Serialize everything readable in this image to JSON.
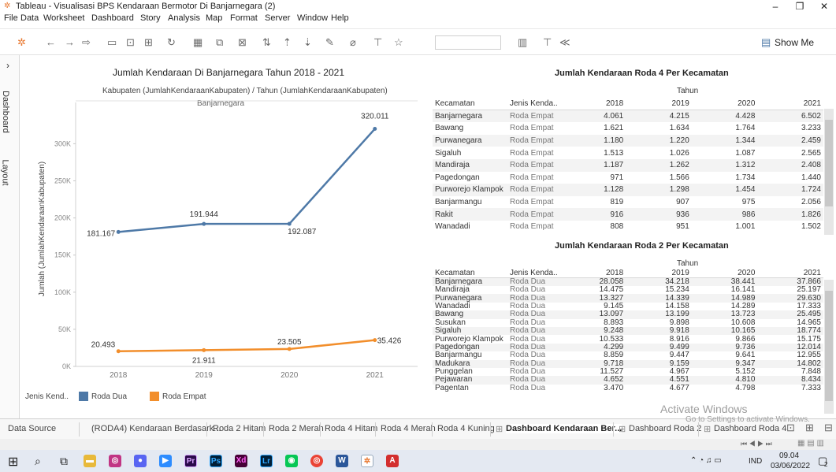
{
  "window": {
    "title": "Tableau - Visualisasi BPS Kendaraan Bermotor Di Banjarnegara (2)",
    "minimize": "–",
    "restore": "❐",
    "close": "✕"
  },
  "menu": [
    "File",
    "Data",
    "Worksheet",
    "Dashboard",
    "Story",
    "Analysis",
    "Map",
    "Format",
    "Server",
    "Window",
    "Help"
  ],
  "toolbar": {
    "show_me": "Show Me"
  },
  "left_rail": {
    "dashboard": "Dashboard",
    "layout": "Layout",
    "collapse": "›"
  },
  "line_chart": {
    "title": "Jumlah Kendaraan Di Banjarnegara Tahun 2018 - 2021",
    "header": "Kabupaten (JumlahKendaraanKabupaten) / Tahun (JumlahKendaraanKabupaten)",
    "subheader": "Banjarnegara",
    "ylabel": "Jumlah (JumlahKendaraanKabupaten)",
    "legend_title": "Jenis Kend..",
    "colors": {
      "Roda Dua": "#4e79a7",
      "Roda Empat": "#f28e2b"
    }
  },
  "chart_data": {
    "type": "line",
    "x": [
      "2018",
      "2019",
      "2020",
      "2021"
    ],
    "ylim": [
      0,
      345000
    ],
    "yticks": [
      0,
      50000,
      100000,
      150000,
      200000,
      250000,
      300000
    ],
    "ytick_labels": [
      "0K",
      "50K",
      "100K",
      "150K",
      "200K",
      "250K",
      "300K"
    ],
    "series": [
      {
        "name": "Roda Dua",
        "values": [
          181167,
          191944,
          192087,
          320011
        ],
        "labels": [
          "181.167",
          "191.944",
          "192.087",
          "320.011"
        ]
      },
      {
        "name": "Roda Empat",
        "values": [
          20493,
          21911,
          23505,
          35426
        ],
        "labels": [
          "20.493",
          "21.911",
          "23.505",
          "35.426"
        ]
      }
    ],
    "xlabel": "",
    "grid": false,
    "legend": "bottom-left"
  },
  "table4": {
    "title": "Jumlah Kendaraan Roda 4 Per Kecamatan",
    "group_header": "Tahun",
    "columns": [
      "Kecamatan",
      "Jenis Kenda..",
      "2018",
      "2019",
      "2020",
      "2021"
    ],
    "rows": [
      [
        "Banjarnegara",
        "Roda Empat",
        "4.061",
        "4.215",
        "4.428",
        "6.502"
      ],
      [
        "Bawang",
        "Roda Empat",
        "1.621",
        "1.634",
        "1.764",
        "3.233"
      ],
      [
        "Purwanegara",
        "Roda Empat",
        "1.180",
        "1.220",
        "1.344",
        "2.459"
      ],
      [
        "Sigaluh",
        "Roda Empat",
        "1.513",
        "1.026",
        "1.087",
        "2.565"
      ],
      [
        "Mandiraja",
        "Roda Empat",
        "1.187",
        "1.262",
        "1.312",
        "2.408"
      ],
      [
        "Pagedongan",
        "Roda Empat",
        "971",
        "1.566",
        "1.734",
        "1.440"
      ],
      [
        "Purworejo Klampok",
        "Roda Empat",
        "1.128",
        "1.298",
        "1.454",
        "1.724"
      ],
      [
        "Banjarmangu",
        "Roda Empat",
        "819",
        "907",
        "975",
        "2.056"
      ],
      [
        "Rakit",
        "Roda Empat",
        "916",
        "936",
        "986",
        "1.826"
      ],
      [
        "Wanadadi",
        "Roda Empat",
        "808",
        "951",
        "1.001",
        "1.502"
      ]
    ]
  },
  "table2": {
    "title": "Jumlah Kendaraan Roda 2 Per Kecamatan",
    "group_header": "Tahun",
    "columns": [
      "Kecamatan",
      "Jenis Kenda..",
      "2018",
      "2019",
      "2020",
      "2021"
    ],
    "rows": [
      [
        "Banjarnegara",
        "Roda Dua",
        "28.058",
        "34.218",
        "38.441",
        "37.866"
      ],
      [
        "Mandiraja",
        "Roda Dua",
        "14.475",
        "15.234",
        "16.141",
        "25.197"
      ],
      [
        "Purwanegara",
        "Roda Dua",
        "13.327",
        "14.339",
        "14.989",
        "29.630"
      ],
      [
        "Wanadadi",
        "Roda Dua",
        "9.145",
        "14.158",
        "14.289",
        "17.333"
      ],
      [
        "Bawang",
        "Roda Dua",
        "13.097",
        "13.199",
        "13.723",
        "25.495"
      ],
      [
        "Susukan",
        "Roda Dua",
        "8.893",
        "9.898",
        "10.608",
        "14.965"
      ],
      [
        "Sigaluh",
        "Roda Dua",
        "9.248",
        "9.918",
        "10.165",
        "18.774"
      ],
      [
        "Purworejo Klampok",
        "Roda Dua",
        "10.533",
        "8.916",
        "9.866",
        "15.175"
      ],
      [
        "Pagedongan",
        "Roda Dua",
        "4.299",
        "9.499",
        "9.736",
        "12.014"
      ],
      [
        "Banjarmangu",
        "Roda Dua",
        "8.859",
        "9.447",
        "9.641",
        "12.955"
      ],
      [
        "Madukara",
        "Roda Dua",
        "9.718",
        "9.159",
        "9.347",
        "14.802"
      ],
      [
        "Punggelan",
        "Roda Dua",
        "11.527",
        "4.967",
        "5.152",
        "7.848"
      ],
      [
        "Pejawaran",
        "Roda Dua",
        "4.652",
        "4.551",
        "4.810",
        "8.434"
      ],
      [
        "Pagentan",
        "Roda Dua",
        "3.470",
        "4.677",
        "4.798",
        "7.333"
      ]
    ]
  },
  "sheet_tabs": {
    "data_source": "Data Source",
    "tabs": [
      "(RODA4) Kendaraan Berdasark...",
      "Roda 2 Hitam",
      "Roda 2 Merah",
      "Roda 4 Hitam",
      "Roda 4 Merah",
      "Roda 4 Kuning"
    ],
    "active": "Dashboard Kendaraan Ber...",
    "after": [
      "Dashboard Roda 2",
      "Dashboard Roda 4"
    ]
  },
  "watermark": {
    "line1": "Activate Windows",
    "line2": "Go to Settings to activate Windows."
  },
  "taskbar": {
    "lang": "IND",
    "time": "09.04",
    "date": "03/06/2022",
    "notifications": "2"
  }
}
